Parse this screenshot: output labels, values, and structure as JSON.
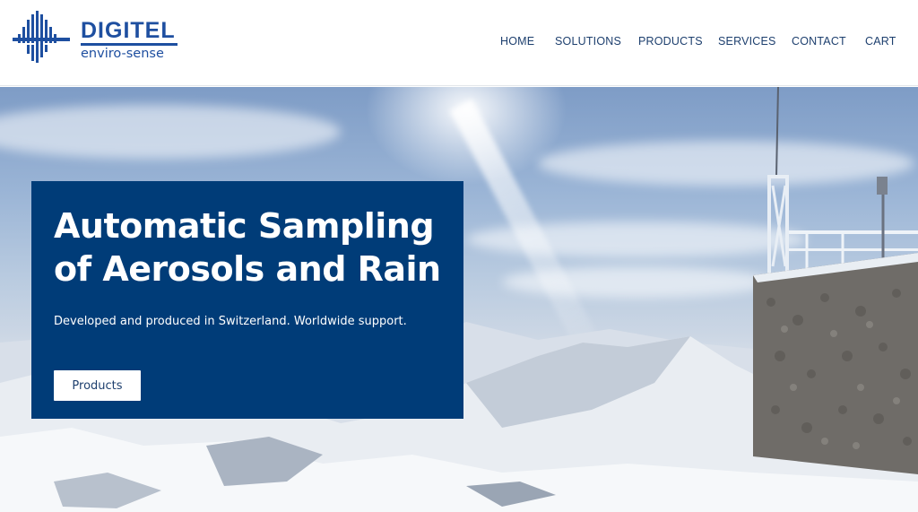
{
  "header": {
    "logo": {
      "name": "DIGITEL",
      "tagline": "enviro-sense"
    },
    "nav": [
      {
        "label": "HOME"
      },
      {
        "label": "SOLUTIONS"
      },
      {
        "label": "PRODUCTS"
      },
      {
        "label": "SERVICES"
      },
      {
        "label": "CONTACT"
      },
      {
        "label": "CART"
      }
    ]
  },
  "hero": {
    "title": "Automatic Sampling of Aerosols and Rain",
    "subtitle": "Developed and produced in Switzerland. Worldwide support.",
    "button_label": "Products"
  },
  "colors": {
    "brand": "#1e4fa0",
    "nav_text": "#1d3f6e",
    "hero_card": "#003c78",
    "button_bg": "#ffffff"
  },
  "icons": [
    "digitel-logo-icon"
  ]
}
